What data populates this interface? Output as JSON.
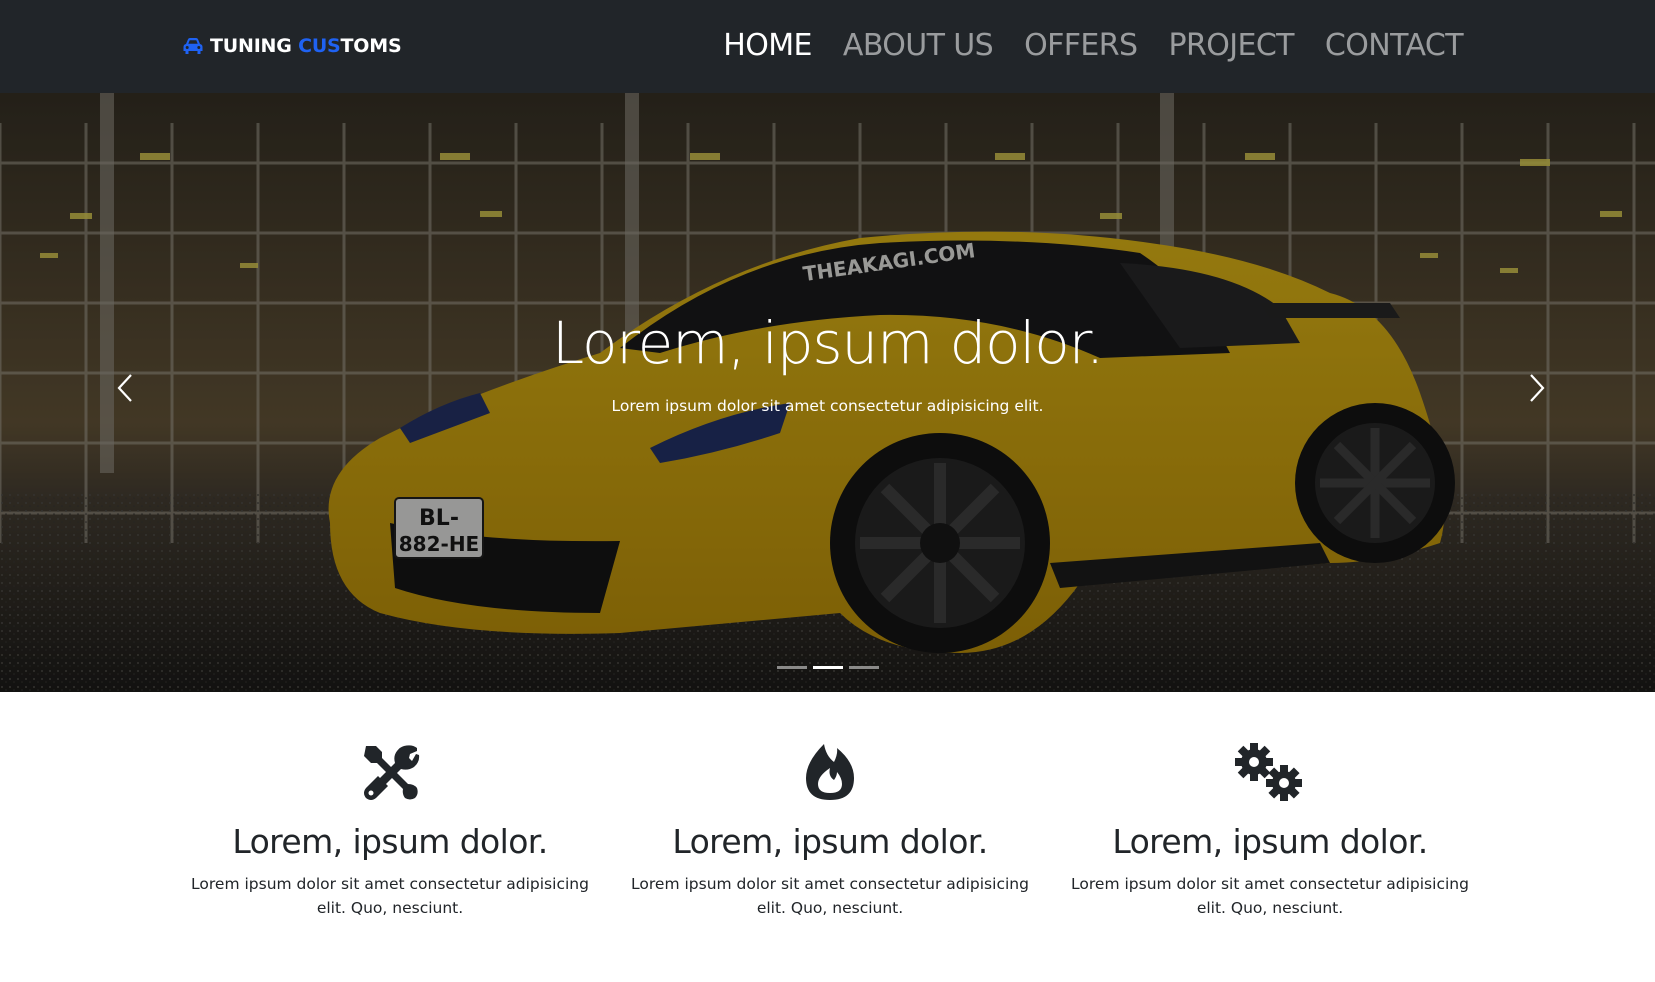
{
  "navbar": {
    "brand_part1": "TUNING ",
    "brand_highlight": "CUS",
    "brand_part2": "TOMS",
    "brand_icon": "car-icon",
    "brand_color": "#1f62f2",
    "links": [
      {
        "label": "HOME",
        "active": true
      },
      {
        "label": "ABOUT US",
        "active": false
      },
      {
        "label": "OFFERS",
        "active": false
      },
      {
        "label": "PROJECT",
        "active": false
      },
      {
        "label": "CONTACT",
        "active": false
      }
    ]
  },
  "hero": {
    "title": "Lorem, ipsum dolor.",
    "text": "Lorem ipsum dolor sit amet consectetur adipisicing elit.",
    "plate_line1": "BL-",
    "plate_line2": "882-HE",
    "windshield_banner": "THEAKAGI.COM",
    "slides": 3,
    "active_slide": 2,
    "prev_icon": "chevron-left-icon",
    "next_icon": "chevron-right-icon"
  },
  "features": [
    {
      "icon": "tools-icon",
      "title": "Lorem, ipsum dolor.",
      "text": "Lorem ipsum dolor sit amet consectetur adipisicing elit. Quo, nesciunt."
    },
    {
      "icon": "fire-icon",
      "title": "Lorem, ipsum dolor.",
      "text": "Lorem ipsum dolor sit amet consectetur adipisicing elit. Quo, nesciunt."
    },
    {
      "icon": "cogs-icon",
      "title": "Lorem, ipsum dolor.",
      "text": "Lorem ipsum dolor sit amet consectetur adipisicing elit. Quo, nesciunt."
    }
  ]
}
